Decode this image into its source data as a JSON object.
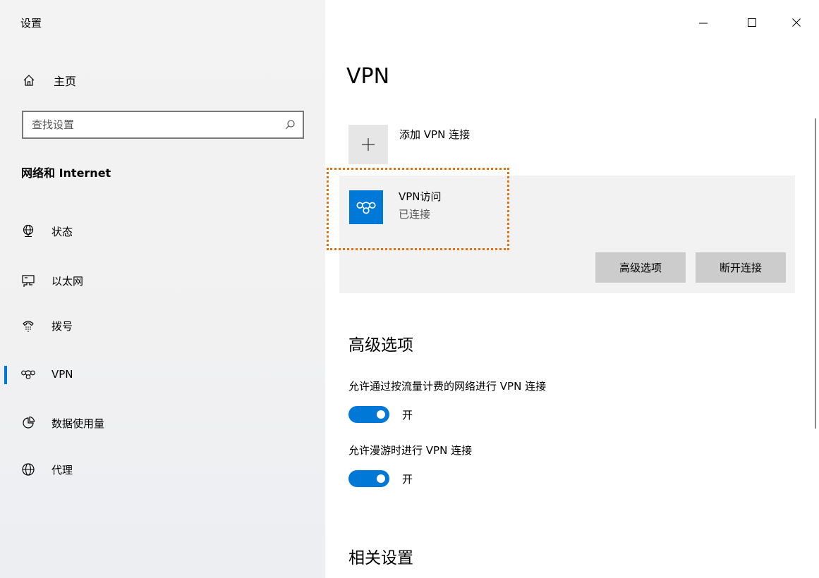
{
  "app": {
    "title": "设置"
  },
  "sidebar": {
    "home_label": "主页",
    "search_placeholder": "查找设置",
    "section_title": "网络和 Internet",
    "items": [
      {
        "label": "状态",
        "icon": "globe-status-icon"
      },
      {
        "label": "以太网",
        "icon": "ethernet-icon"
      },
      {
        "label": "拨号",
        "icon": "dialup-icon"
      },
      {
        "label": "VPN",
        "icon": "vpn-icon",
        "selected": true
      },
      {
        "label": "数据使用量",
        "icon": "data-usage-icon"
      },
      {
        "label": "代理",
        "icon": "globe-icon"
      }
    ]
  },
  "window_controls": {
    "minimize": "—",
    "maximize": "☐",
    "close": "✕"
  },
  "main": {
    "page_title": "VPN",
    "add_vpn_label": "添加 VPN 连接",
    "connection": {
      "name": "VPN访问",
      "status": "已连接",
      "advanced_button": "高级选项",
      "disconnect_button": "断开连接"
    },
    "advanced": {
      "title": "高级选项",
      "options": [
        {
          "label": "允许通过按流量计费的网络进行 VPN 连接",
          "state": "开",
          "on": true
        },
        {
          "label": "允许漫游时进行 VPN 连接",
          "state": "开",
          "on": true
        }
      ]
    },
    "related_title": "相关设置"
  },
  "colors": {
    "accent": "#0078d7",
    "highlight": "#e5700e"
  }
}
